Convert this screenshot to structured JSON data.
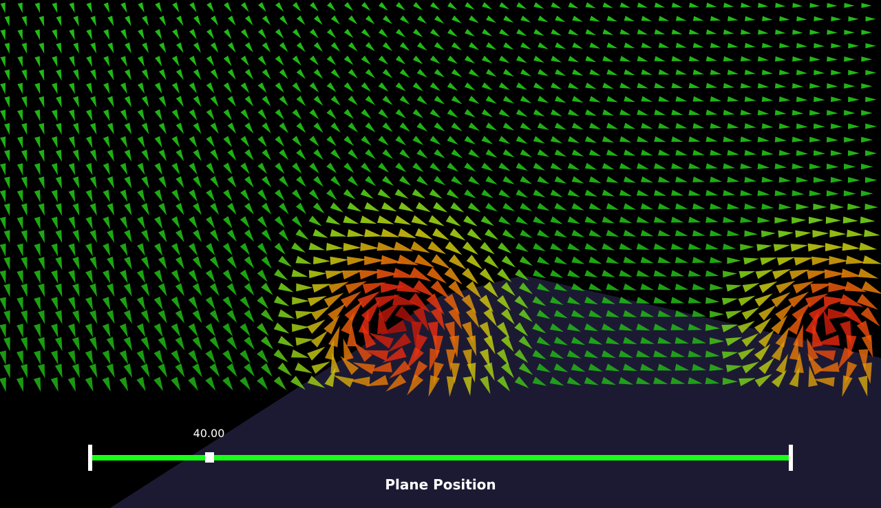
{
  "viewport": {
    "background_color": "#000000",
    "ground_plane_color": "#1c1a33"
  },
  "glyph_field": {
    "glyph_shape": "arrow-cone",
    "color_map": [
      "#00903c",
      "#16b816",
      "#7ad81a",
      "#c8cc10",
      "#e87a08",
      "#e82a10",
      "#a81008"
    ],
    "vortices": [
      {
        "location": "center",
        "rotation": "clockwise"
      },
      {
        "location": "right-edge",
        "rotation": "clockwise"
      }
    ]
  },
  "slider": {
    "title": "Plane Position",
    "value_label": "40.00",
    "value_fraction": 0.168,
    "track_color": "#18ff18",
    "handle_color": "#ffffff"
  }
}
